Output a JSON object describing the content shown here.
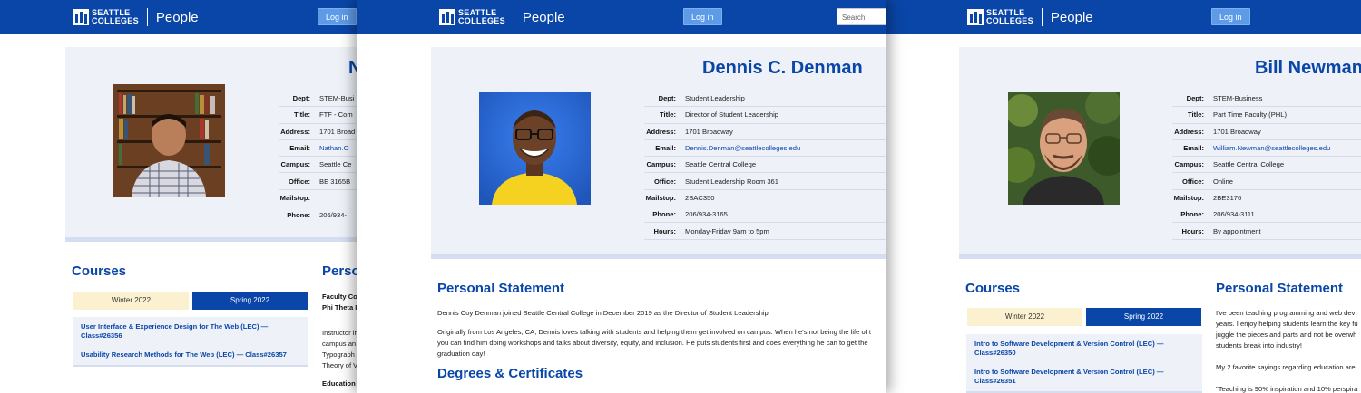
{
  "header": {
    "logo_line1": "SEATTLE",
    "logo_line2": "COLLEGES",
    "app_title": "People",
    "login_label": "Log in",
    "search_placeholder": "Search"
  },
  "labels": {
    "dept": "Dept:",
    "title": "Title:",
    "address": "Address:",
    "email": "Email:",
    "campus": "Campus:",
    "office": "Office:",
    "mailstop": "Mailstop:",
    "phone": "Phone:",
    "hours": "Hours:",
    "courses": "Courses",
    "personal_statement": "Personal Statement",
    "degrees": "Degrees & Certificates",
    "winter": "Winter 2022",
    "spring": "Spring 2022"
  },
  "profile1": {
    "name": "N",
    "dept": "STEM-Busi",
    "title": "FTF - Com",
    "address": "1701 Broad",
    "email": "Nathan.O",
    "campus": "Seattle Ce",
    "office": "BE 3165B",
    "mailstop": "",
    "phone": "206/934-",
    "personal_statement_title": "Perso",
    "courses": [
      "User Interface & Experience Design for The Web (LEC) — Class#26356",
      "Usability Research Methods for The Web (LEC) — Class#26357"
    ],
    "faculty_line1": "Faculty Co",
    "faculty_line2": "Phi Theta I",
    "statement_lines": [
      "Instructor in",
      "campus an",
      "Typograph",
      "Theory of V"
    ],
    "education_label": "Education"
  },
  "profile2": {
    "name": "Dennis C. Denman",
    "dept": "Student Leadership",
    "title": "Director of Student Leadership",
    "address": "1701 Broadway",
    "email": "Dennis.Denman@seattlecolleges.edu",
    "campus": "Seattle Central College",
    "office": "Student Leadership Room 361",
    "mailstop": "2SAC350",
    "phone": "206/934-3165",
    "hours": "Monday-Friday 9am to 5pm",
    "statement_p1": "Dennis Coy Denman joined Seattle Central College in December 2019 as the Director of Student Leadership",
    "statement_p2_l1": "Originally from Los Angeles, CA, Dennis loves talking with students and helping them get involved on campus. When he's not being the life of t",
    "statement_p2_l2": "you can find him doing workshops and talks about diversity, equity, and inclusion. He puts students first and does everything he can to get the",
    "statement_p2_l3": "graduation day!"
  },
  "profile3": {
    "name": "Bill Newman",
    "dept": "STEM-Business",
    "title": "Part Time Faculty (PHL)",
    "address": "1701 Broadway",
    "email": "William.Newman@seattlecolleges.edu",
    "campus": "Seattle Central College",
    "office": "Online",
    "mailstop": "2BE3176",
    "phone": "206/934-3111",
    "hours": "By appointment",
    "courses": [
      "Intro to Software Development & Version Control (LEC) — Class#26350",
      "Intro to Software Development & Version Control (LEC) — Class#26351"
    ],
    "statement_lines": [
      "I've been teaching programming and web dev",
      "years. I enjoy helping students learn the key fu",
      "juggle the pieces and parts and not be overwh",
      "students break into industry!"
    ],
    "statement_p2": "My 2 favorite sayings regarding education are",
    "statement_p3": "\"Teaching is 90% inspiration and 10% perspira"
  },
  "colors": {
    "brand_blue": "#0a46a8",
    "card_bg": "#eef2f8",
    "tab_inactive": "#fbf0d0"
  }
}
